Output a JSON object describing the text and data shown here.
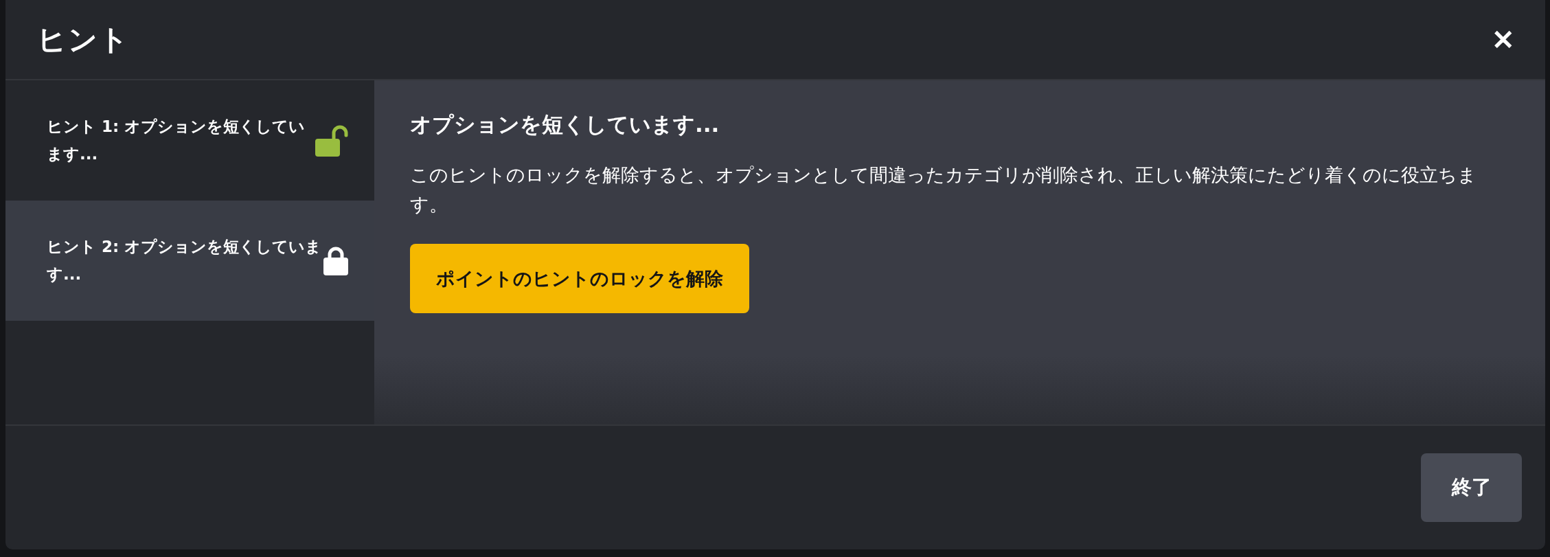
{
  "dialog": {
    "title": "ヒント",
    "close": "✕"
  },
  "hints": [
    {
      "label": "ヒント 1: オプションを短くしています...",
      "unlocked": true,
      "selected": false
    },
    {
      "label": "ヒント 2: オプションを短くしています...",
      "unlocked": false,
      "selected": true
    }
  ],
  "content": {
    "heading": "オプションを短くしています...",
    "body": "このヒントのロックを解除すると、オプションとして間違ったカテゴリが削除され、正しい解決策にたどり着くのに役立ちます。",
    "unlock_button": "ポイントのヒントのロックを解除"
  },
  "footer": {
    "finish_button": "終了"
  }
}
